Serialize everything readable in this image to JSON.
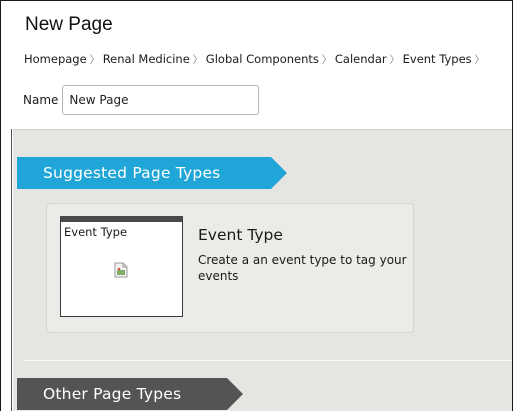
{
  "page": {
    "title": "New Page"
  },
  "breadcrumb": {
    "items": [
      "Homepage",
      "Renal Medicine",
      "Global Components",
      "Calendar",
      "Event Types",
      ""
    ],
    "separator": "〉"
  },
  "name_field": {
    "label": "Name",
    "value": "New Page"
  },
  "suggested": {
    "heading": "Suggested Page Types",
    "types": [
      {
        "thumbnail_label": "Event Type",
        "title": "Event Type",
        "description": "Create a an event type to tag your events",
        "thumbnail_icon": "broken-image-icon"
      }
    ]
  },
  "other": {
    "heading": "Other Page Types"
  },
  "colors": {
    "accent": "#1fa5d8",
    "other_ribbon": "#545454",
    "content_bg": "#e5e5e1"
  }
}
